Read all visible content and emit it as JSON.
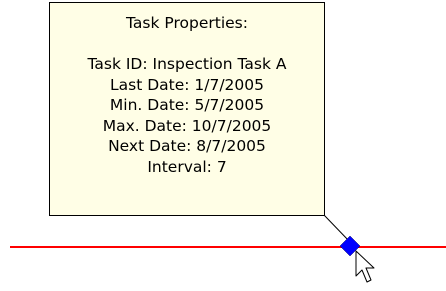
{
  "tooltip": {
    "title": "Task Properties:",
    "task_id": "Task ID: Inspection Task A",
    "last_date": "Last Date: 1/7/2005",
    "min_date": "Min. Date: 5/7/2005",
    "max_date": "Max. Date: 10/7/2005",
    "next_date": "Next Date: 8/7/2005",
    "interval": "Interval: 7"
  },
  "colors": {
    "timeline": "#ff0000",
    "marker": "#0000ff",
    "tooltip_background": "#fffee6"
  },
  "icons": {
    "marker": "diamond-task-marker",
    "cursor": "arrow-pointer-cursor"
  }
}
